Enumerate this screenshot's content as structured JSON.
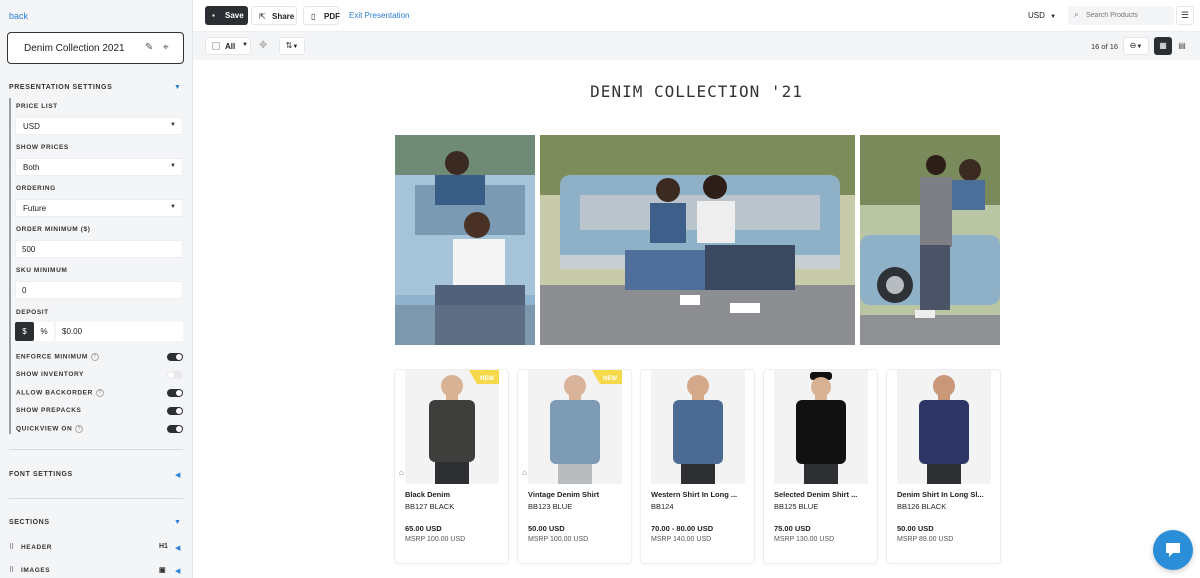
{
  "sidebar": {
    "back_label": "back",
    "collection_title": "Denim Collection 2021",
    "presentation_settings": {
      "heading": "PRESENTATION SETTINGS",
      "price_list": {
        "label": "PRICE LIST",
        "value": "USD"
      },
      "show_prices": {
        "label": "SHOW PRICES",
        "value": "Both"
      },
      "ordering": {
        "label": "ORDERING",
        "value": "Future"
      },
      "order_minimum": {
        "label": "ORDER MINIMUM ($)",
        "value": "500"
      },
      "sku_minimum": {
        "label": "SKU MINIMUM",
        "value": "0"
      },
      "deposit": {
        "label": "DEPOSIT",
        "dollar": "$",
        "percent": "%",
        "value": "$0.00"
      },
      "toggles": [
        {
          "label": "ENFORCE MINIMUM",
          "on": true,
          "help": true
        },
        {
          "label": "SHOW INVENTORY",
          "on": false,
          "help": false
        },
        {
          "label": "ALLOW BACKORDER",
          "on": true,
          "help": true
        },
        {
          "label": "SHOW PREPACKS",
          "on": true,
          "help": false
        },
        {
          "label": "QUICKVIEW ON",
          "on": true,
          "help": true
        }
      ]
    },
    "font_settings": {
      "heading": "FONT SETTINGS"
    },
    "sections": {
      "heading": "SECTIONS",
      "items": [
        {
          "label": "HEADER",
          "icon": "H1"
        },
        {
          "label": "IMAGES",
          "icon": "image-icon"
        }
      ]
    }
  },
  "topbar": {
    "save_label": "Save",
    "share_label": "Share",
    "pdf_label": "PDF",
    "exit_label": "Exit Presentation",
    "currency": "USD",
    "search_placeholder": "Search Products"
  },
  "toolbar": {
    "all_label": "All",
    "page_count": "16 of 16"
  },
  "presentation": {
    "title": "DENIM COLLECTION '21"
  },
  "products": [
    {
      "name": "Black Denim",
      "sku": "BB127 BLACK",
      "price": "65.00 USD",
      "msrp": "MSRP 100.00 USD",
      "new": true,
      "new_label": "NEW",
      "shirt_color": "#3e3f3c"
    },
    {
      "name": "Vintage Denim Shirt",
      "sku": "BB123 BLUE",
      "price": "50.00 USD",
      "msrp": "MSRP 100.00 USD",
      "new": true,
      "new_label": "NEW",
      "shirt_color": "#7e9bb5"
    },
    {
      "name": "Western Shirt In Long ...",
      "sku": "BB124",
      "price": "70.00 - 80.00 USD",
      "msrp": "MSRP 140.00 USD",
      "new": false,
      "shirt_color": "#4b6a94"
    },
    {
      "name": "Selected Denim Shirt ...",
      "sku": "BB125 BLUE",
      "price": "75.00 USD",
      "msrp": "MSRP 130.00 USD",
      "new": false,
      "shirt_color": "#111111"
    },
    {
      "name": "Denim Shirt In Long Sl...",
      "sku": "BB126 BLACK",
      "price": "50.00 USD",
      "msrp": "MSRP 89.00 USD",
      "new": false,
      "shirt_color": "#2c3566"
    }
  ],
  "colors": {
    "accent": "#2f7ed8",
    "dark": "#2b2e33",
    "badge": "#f5d94a",
    "chat": "#2b8ed9"
  }
}
